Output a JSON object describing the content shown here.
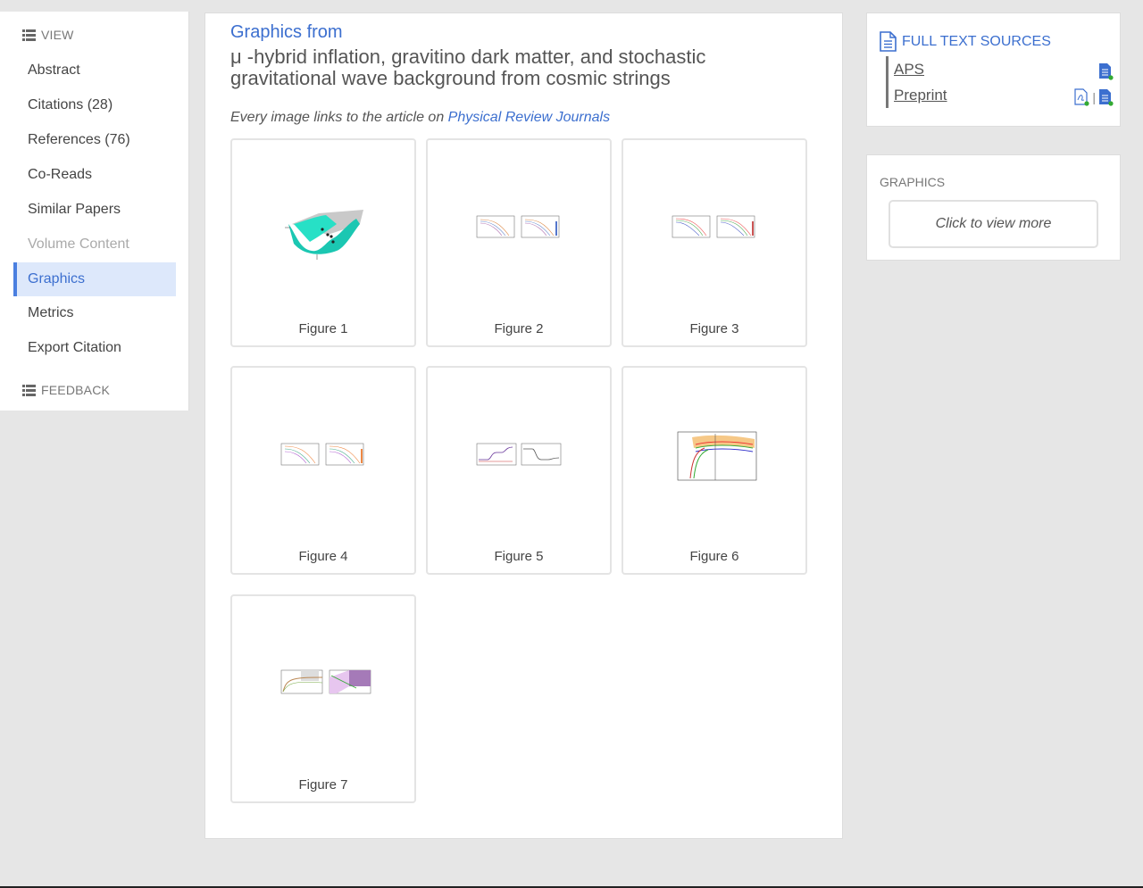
{
  "sidebar": {
    "view_label": "VIEW",
    "items": [
      {
        "label": "Abstract"
      },
      {
        "label": "Citations (28)"
      },
      {
        "label": "References (76)"
      },
      {
        "label": "Co-Reads"
      },
      {
        "label": "Similar Papers"
      },
      {
        "label": "Volume Content"
      },
      {
        "label": "Graphics"
      },
      {
        "label": "Metrics"
      },
      {
        "label": "Export Citation"
      }
    ],
    "feedback_label": "FEEDBACK"
  },
  "main": {
    "heading": "Graphics from",
    "paper_title": "μ -hybrid inflation, gravitino dark matter, and stochastic gravitational wave background from cosmic strings",
    "note_prefix": "Every image links to the article on",
    "note_link": "Physical Review Journals",
    "figures": [
      {
        "caption": "Figure 1"
      },
      {
        "caption": "Figure 2"
      },
      {
        "caption": "Figure 3"
      },
      {
        "caption": "Figure 4"
      },
      {
        "caption": "Figure 5"
      },
      {
        "caption": "Figure 6"
      },
      {
        "caption": "Figure 7"
      }
    ]
  },
  "full_text": {
    "heading": "FULL TEXT SOURCES",
    "sources": [
      {
        "label": "APS"
      },
      {
        "label": "Preprint"
      }
    ],
    "separator": "|"
  },
  "graphics_panel": {
    "heading": "GRAPHICS",
    "button": "Click to view more"
  },
  "colors": {
    "accent": "#3c6fcf",
    "active_bg": "#dde8fb",
    "page_bg": "#e6e6e6"
  }
}
